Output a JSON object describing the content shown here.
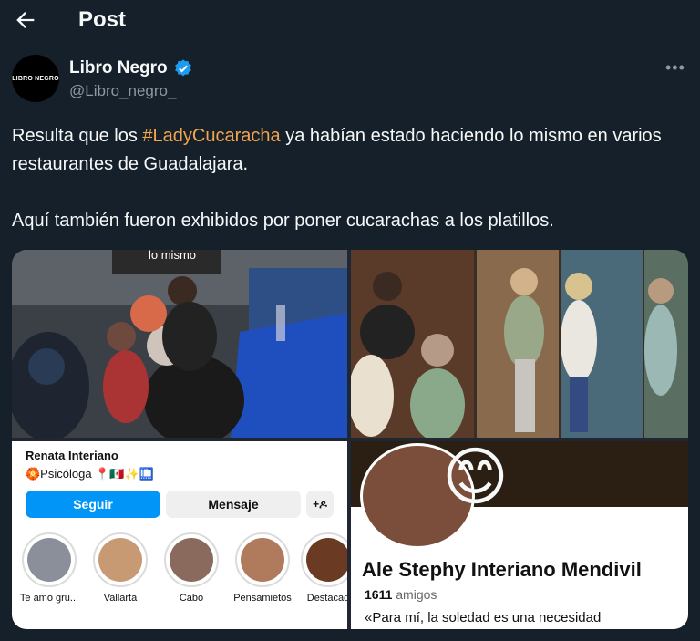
{
  "header": {
    "title": "Post",
    "back_icon": "arrow-left-icon"
  },
  "author": {
    "avatar_text": "LIBRO NEGRO",
    "name": "Libro Negro",
    "handle": "@Libro_negro_",
    "verified_icon": "verified-badge-icon",
    "verified_color": "#1d9bf0"
  },
  "more_icon": "•••",
  "tweet": {
    "line1_before": "Resulta que los ",
    "hashtag": "#LadyCucaracha",
    "line1_after": " ya habían estado haciendo lo mismo en varios restaurantes de Guadalajara.",
    "line2": "Aquí también fueron exhibidos por poner cucarachas a los platillos.",
    "hashtag_color": "#f4a44c"
  },
  "media": {
    "photo1_caption": "lo mismo",
    "instagram": {
      "name": "Renata Interiano",
      "bio": "🏵️Psicóloga 📍🇲🇽✨🛄",
      "follow_label": "Seguir",
      "message_label": "Mensaje",
      "add_label": "+ዶ",
      "highlights": [
        {
          "label": "Te amo gru..."
        },
        {
          "label": "Vallarta"
        },
        {
          "label": "Cabo"
        },
        {
          "label": "Pensamietos"
        },
        {
          "label": "Destacad"
        }
      ]
    },
    "facebook": {
      "emoji": "😊",
      "name": "Ale Stephy Interiano Mendivil",
      "friends_count": "1611",
      "friends_label": " amigos",
      "quote": "«Para mí, la soledad es una necesidad"
    }
  }
}
